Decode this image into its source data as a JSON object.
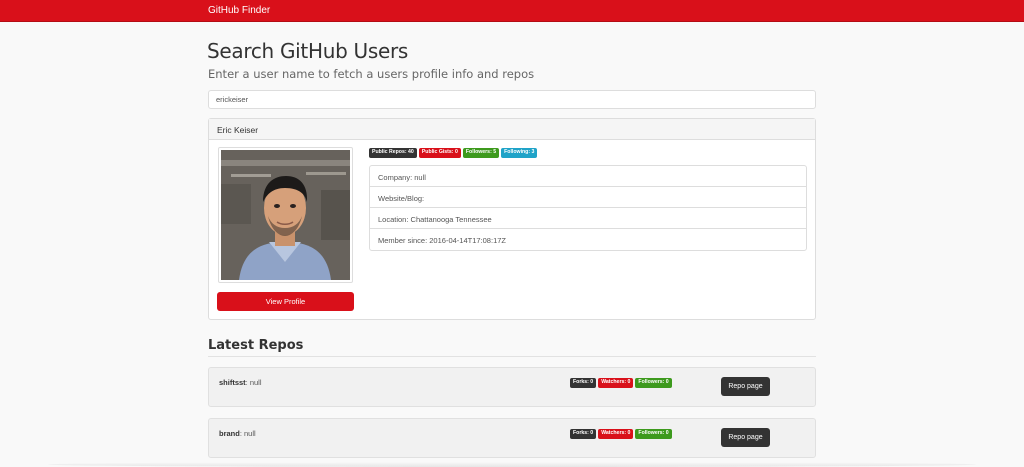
{
  "navbar": {
    "brand": "GitHub Finder"
  },
  "header": {
    "title": "Search GitHub Users",
    "subtitle": "Enter a user name to fetch a users profile info and repos"
  },
  "search": {
    "value": "erickeiser"
  },
  "profile": {
    "name": "Eric Keiser",
    "view_profile_label": "View Profile",
    "badges": {
      "public_repos": "Public Repos: 40",
      "public_gists": "Public Gists: 0",
      "followers": "Followers: 5",
      "following": "Following: 3"
    },
    "info": {
      "company": "Company: null",
      "website": "Website/Blog:",
      "location": "Location: Chattanooga Tennessee",
      "member_since": "Member since: 2016-04-14T17:08:17Z"
    }
  },
  "repos": {
    "title": "Latest Repos",
    "items": [
      {
        "name": "shiftsst",
        "description": ": null",
        "forks": "Forks: 0",
        "watchers": "Watchers: 0",
        "followers": "Followers: 0",
        "button": "Repo page"
      },
      {
        "name": "brand",
        "description": ": null",
        "forks": "Forks: 0",
        "watchers": "Watchers: 0",
        "followers": "Followers: 0",
        "button": "Repo page"
      }
    ]
  },
  "colors": {
    "brand_red": "#d9101a",
    "badge_dark": "#333333",
    "badge_green": "#3d9a1d",
    "badge_cyan": "#1fa3c8"
  },
  "icons": {
    "avatar": "user-photo"
  }
}
